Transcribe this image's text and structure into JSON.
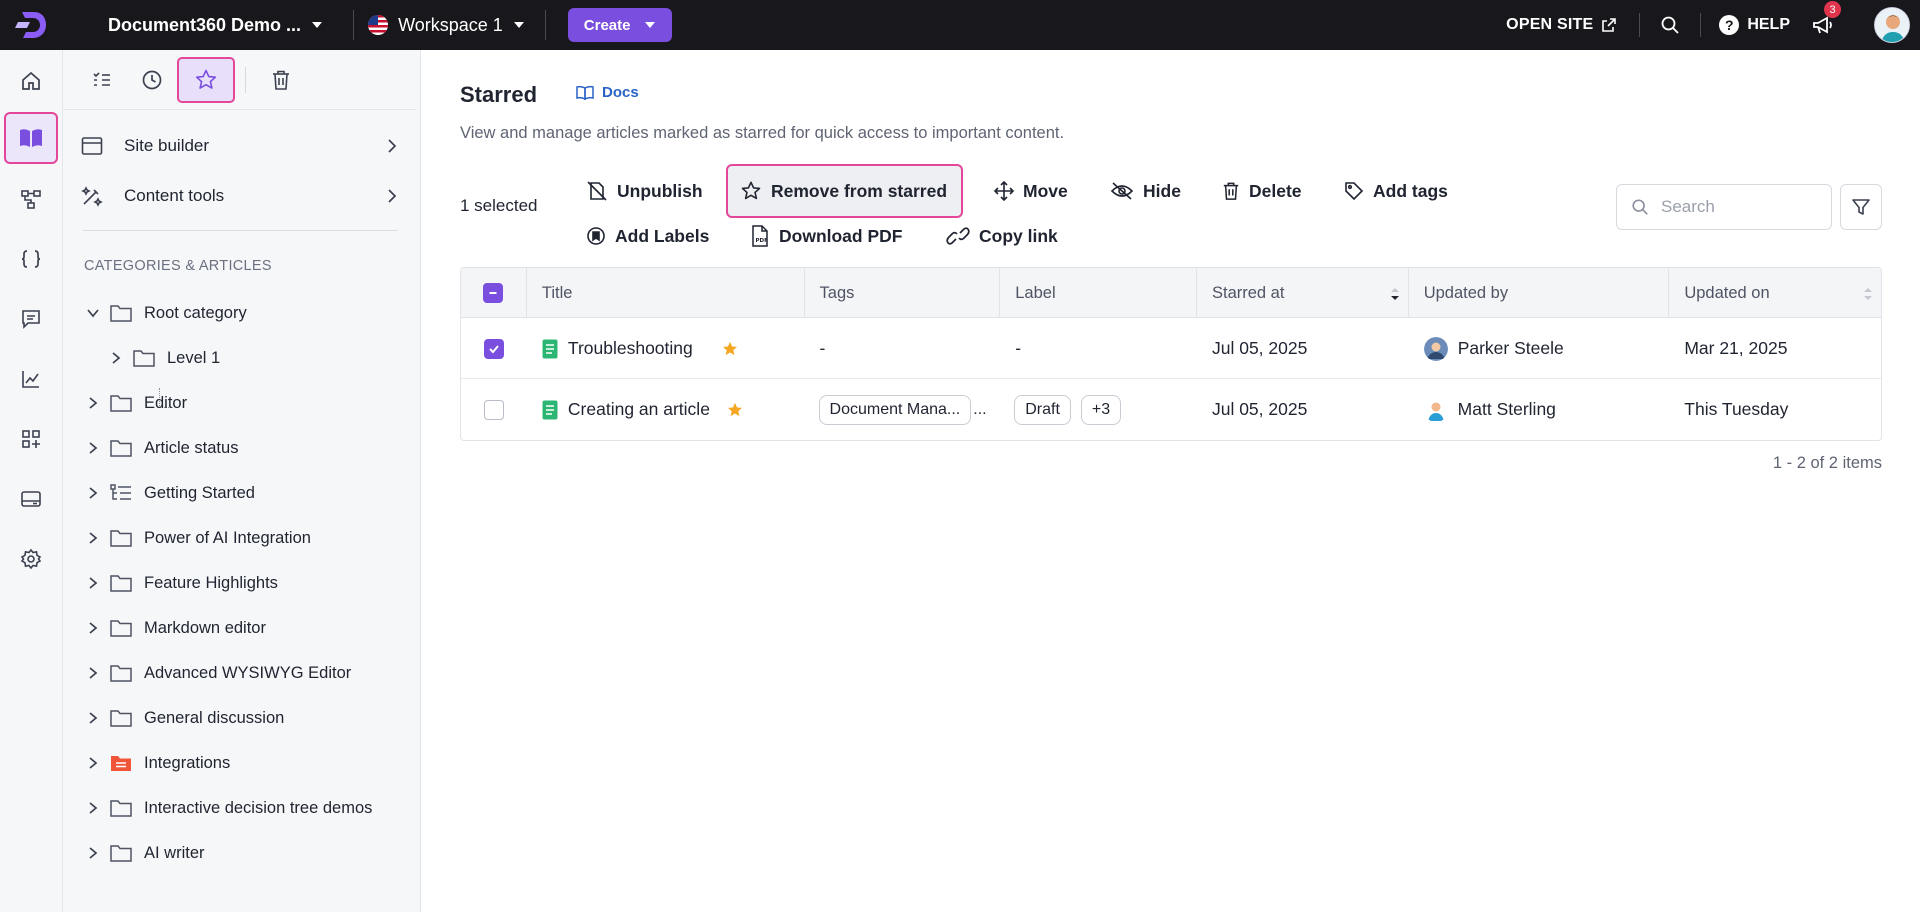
{
  "topbar": {
    "project_name": "Document360 Demo ...",
    "workspace": "Workspace 1",
    "create_label": "Create",
    "open_site_label": "OPEN SITE",
    "help_label": "HELP",
    "notification_count": "3"
  },
  "rail": {
    "items": [
      "home-icon",
      "knowledge-base-icon",
      "workflow-icon",
      "api-docs-icon",
      "feedback-icon",
      "analytics-icon",
      "apps-icon",
      "widgets-icon",
      "settings-icon"
    ],
    "active": "knowledge-base-icon"
  },
  "sidebar": {
    "tools": [
      "checklist-icon",
      "history-icon",
      "star-icon",
      "trash-icon"
    ],
    "active_tool": "star-icon",
    "site_builder_label": "Site builder",
    "content_tools_label": "Content tools",
    "heading": "CATEGORIES & ARTICLES",
    "tree": [
      {
        "name": "Root category",
        "expanded": true
      },
      {
        "name": "Level 1",
        "child": true
      },
      {
        "name": "Editor"
      },
      {
        "name": "Article status"
      },
      {
        "name": "Getting Started"
      },
      {
        "name": "Power of AI Integration"
      },
      {
        "name": "Feature Highlights"
      },
      {
        "name": "Markdown editor"
      },
      {
        "name": "Advanced WYSIWYG Editor"
      },
      {
        "name": "General discussion"
      },
      {
        "name": "Integrations"
      },
      {
        "name": "Interactive decision tree demos"
      },
      {
        "name": "AI writer"
      }
    ]
  },
  "main": {
    "title": "Starred",
    "docs_label": "Docs",
    "description": "View and manage articles marked as starred for quick access to important content.",
    "selected_count": "1 selected",
    "actions": {
      "unpublish": "Unpublish",
      "remove_starred": "Remove from starred",
      "move": "Move",
      "hide": "Hide",
      "delete": "Delete",
      "add_tags": "Add tags",
      "add_labels": "Add Labels",
      "download_pdf": "Download PDF",
      "copy_link": "Copy link"
    },
    "search_placeholder": "Search",
    "columns": [
      "Title",
      "Tags",
      "Label",
      "Starred at",
      "Updated by",
      "Updated on"
    ],
    "rows": [
      {
        "title": "Troubleshooting",
        "tags": "-",
        "label": "-",
        "starred_at": "Jul 05, 2025",
        "updated_by": "Parker Steele",
        "updated_on": "Mar 21, 2025",
        "checked": true
      },
      {
        "title": "Creating an article",
        "tag_chip": "Document Mana...",
        "tag_more": "...",
        "label_chip": "Draft",
        "label_more": "+3",
        "starred_at": "Jul 05, 2025",
        "updated_by": "Matt Sterling",
        "updated_on": "This Tuesday",
        "checked": false
      }
    ],
    "pagination": "1 - 2 of 2 items"
  },
  "colors": {
    "accent": "#7a4fe0",
    "highlight_border": "#e4479a",
    "star": "#f5a623",
    "doc_icon": "#2bb673",
    "topbar_bg": "#17171c"
  }
}
